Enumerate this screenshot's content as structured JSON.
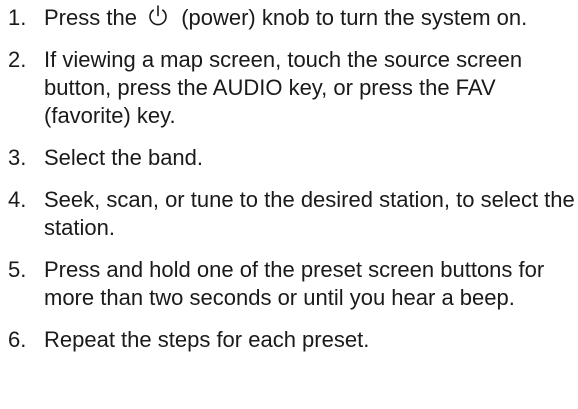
{
  "steps": [
    {
      "number": "1.",
      "before_icon": "Press the",
      "icon": "power-icon",
      "after_icon": "(power) knob to turn the system on."
    },
    {
      "number": "2.",
      "text": "If viewing a map screen, touch the source screen button, press the AUDIO key, or press the FAV (favorite) key."
    },
    {
      "number": "3.",
      "text": "Select the band."
    },
    {
      "number": "4.",
      "text": "Seek, scan, or tune to the desired station, to select the station."
    },
    {
      "number": "5.",
      "text": "Press and hold one of the preset screen buttons for more than two seconds or until you hear a beep."
    },
    {
      "number": "6.",
      "text": "Repeat the steps for each preset."
    }
  ]
}
